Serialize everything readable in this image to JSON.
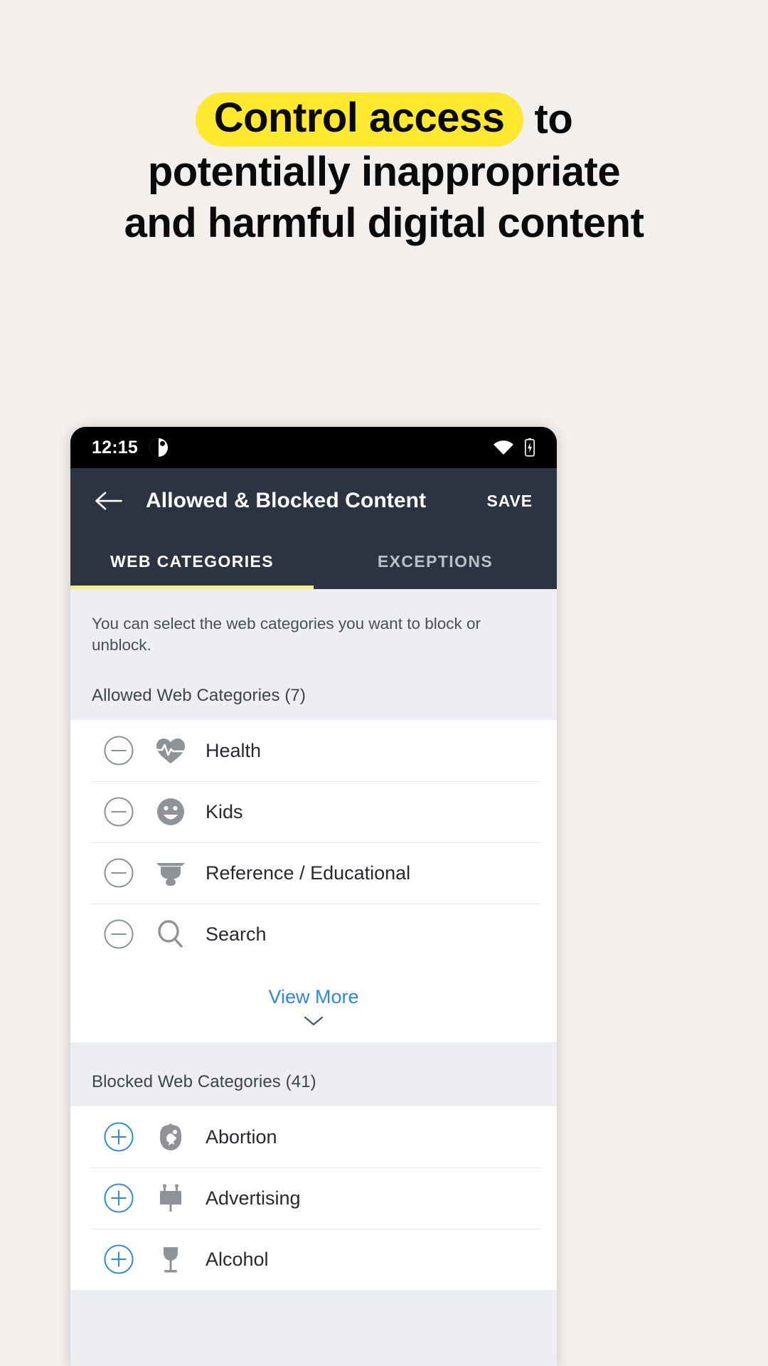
{
  "headline": {
    "highlight": "Control access",
    "line1_tail": "to",
    "line2": "potentially inappropriate",
    "line3": "and harmful digital content",
    "highlight_color": "#ffe92e"
  },
  "phone": {
    "status_bar": {
      "time": "12:15",
      "notification_icon": "notification-dot-icon",
      "wifi_icon": "wifi-icon",
      "battery_icon": "battery-icon"
    },
    "app_bar": {
      "back_icon": "arrow-left-icon",
      "title": "Allowed & Blocked Content",
      "save_label": "SAVE"
    },
    "tabs": [
      {
        "label": "WEB CATEGORIES",
        "active": true
      },
      {
        "label": "EXCEPTIONS",
        "active": false
      }
    ],
    "hint": "You can select the web categories you want to block or unblock.",
    "allowed_section": {
      "title": "Allowed Web Categories (7)",
      "count": 7,
      "action_icon": "minus-circle-icon",
      "items": [
        {
          "label": "Health",
          "icon": "heart-pulse-icon"
        },
        {
          "label": "Kids",
          "icon": "smiley-face-icon"
        },
        {
          "label": "Reference / Educational",
          "icon": "graduation-cap-icon"
        },
        {
          "label": "Search",
          "icon": "magnifier-icon"
        }
      ],
      "view_more_label": "View More",
      "view_more_icon": "chevron-down-icon"
    },
    "blocked_section": {
      "title": "Blocked Web Categories (41)",
      "count": 41,
      "action_icon": "plus-circle-icon",
      "items": [
        {
          "label": "Abortion",
          "icon": "abortion-icon"
        },
        {
          "label": "Advertising",
          "icon": "billboard-icon"
        },
        {
          "label": "Alcohol",
          "icon": "wine-glass-icon"
        }
      ]
    },
    "colors": {
      "app_bar": "#2b3440",
      "tab_indicator": "#f2ef8a",
      "link": "#2a86f0",
      "add_outline": "#2a86f0",
      "remove_outline": "#8a8f96"
    }
  }
}
